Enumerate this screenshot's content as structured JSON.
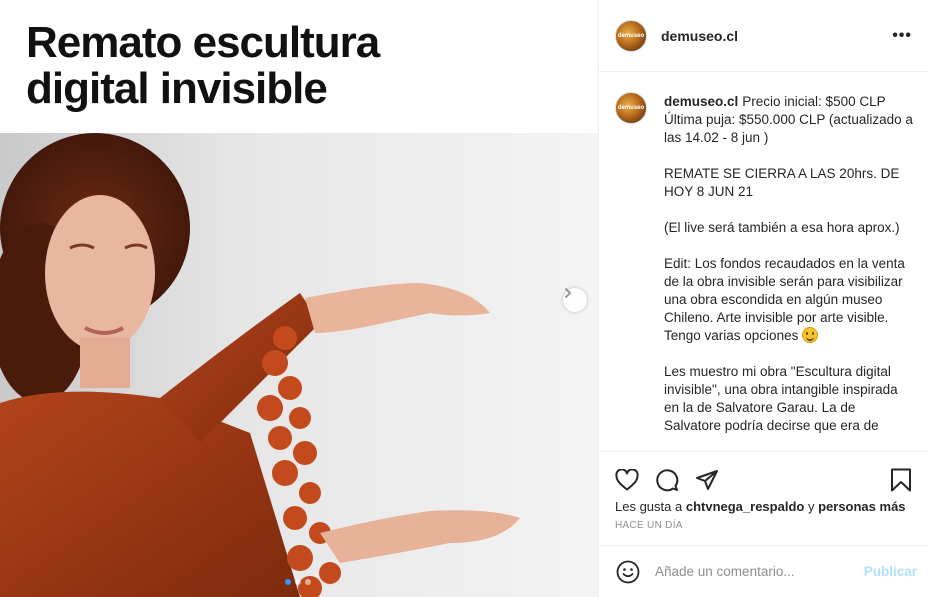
{
  "post": {
    "title_line1": "Remato escultura",
    "title_line2": "digital invisible",
    "carousel": {
      "total": 3,
      "active": 1
    }
  },
  "header": {
    "avatar_text": "demuseo",
    "username": "demuseo.cl",
    "more_icon": "more-options-icon"
  },
  "caption": {
    "username": "demuseo.cl",
    "p1": "Precio inicial: $500 CLP Última puja: $550.000 CLP (actualizado a las 14.02 - 8 jun )",
    "p2": "REMATE SE CIERRA A LAS 20hrs. DE HOY 8 JUN 21",
    "p3": "(El live será también a esa hora aprox.)",
    "p4": "Edit: Los fondos recaudados en la venta de la obra invisible serán para visibilizar una obra escondida en algún museo Chileno. Arte invisible por arte visible. Tengo varias opciones",
    "p5": "Les muestro mi obra \"Escultura digital invisible\", una obra intangible inspirada en la de Salvatore Garau. La de Salvatore podría decirse que era de"
  },
  "actions": {
    "like_icon": "heart-icon",
    "comment_icon": "comment-icon",
    "share_icon": "share-icon",
    "save_icon": "bookmark-icon"
  },
  "likes": {
    "prefix": "Les gusta a",
    "user": "chtvnega_respaldo",
    "connector": "y",
    "others": "personas más"
  },
  "timeago": "HACE UN DÍA",
  "comment_box": {
    "placeholder": "Añade un comentario...",
    "publish_label": "Publicar"
  },
  "colors": {
    "accent": "#3897f0",
    "publish_disabled": "#b2dffc",
    "text": "#262626",
    "muted": "#8e8e8e"
  }
}
